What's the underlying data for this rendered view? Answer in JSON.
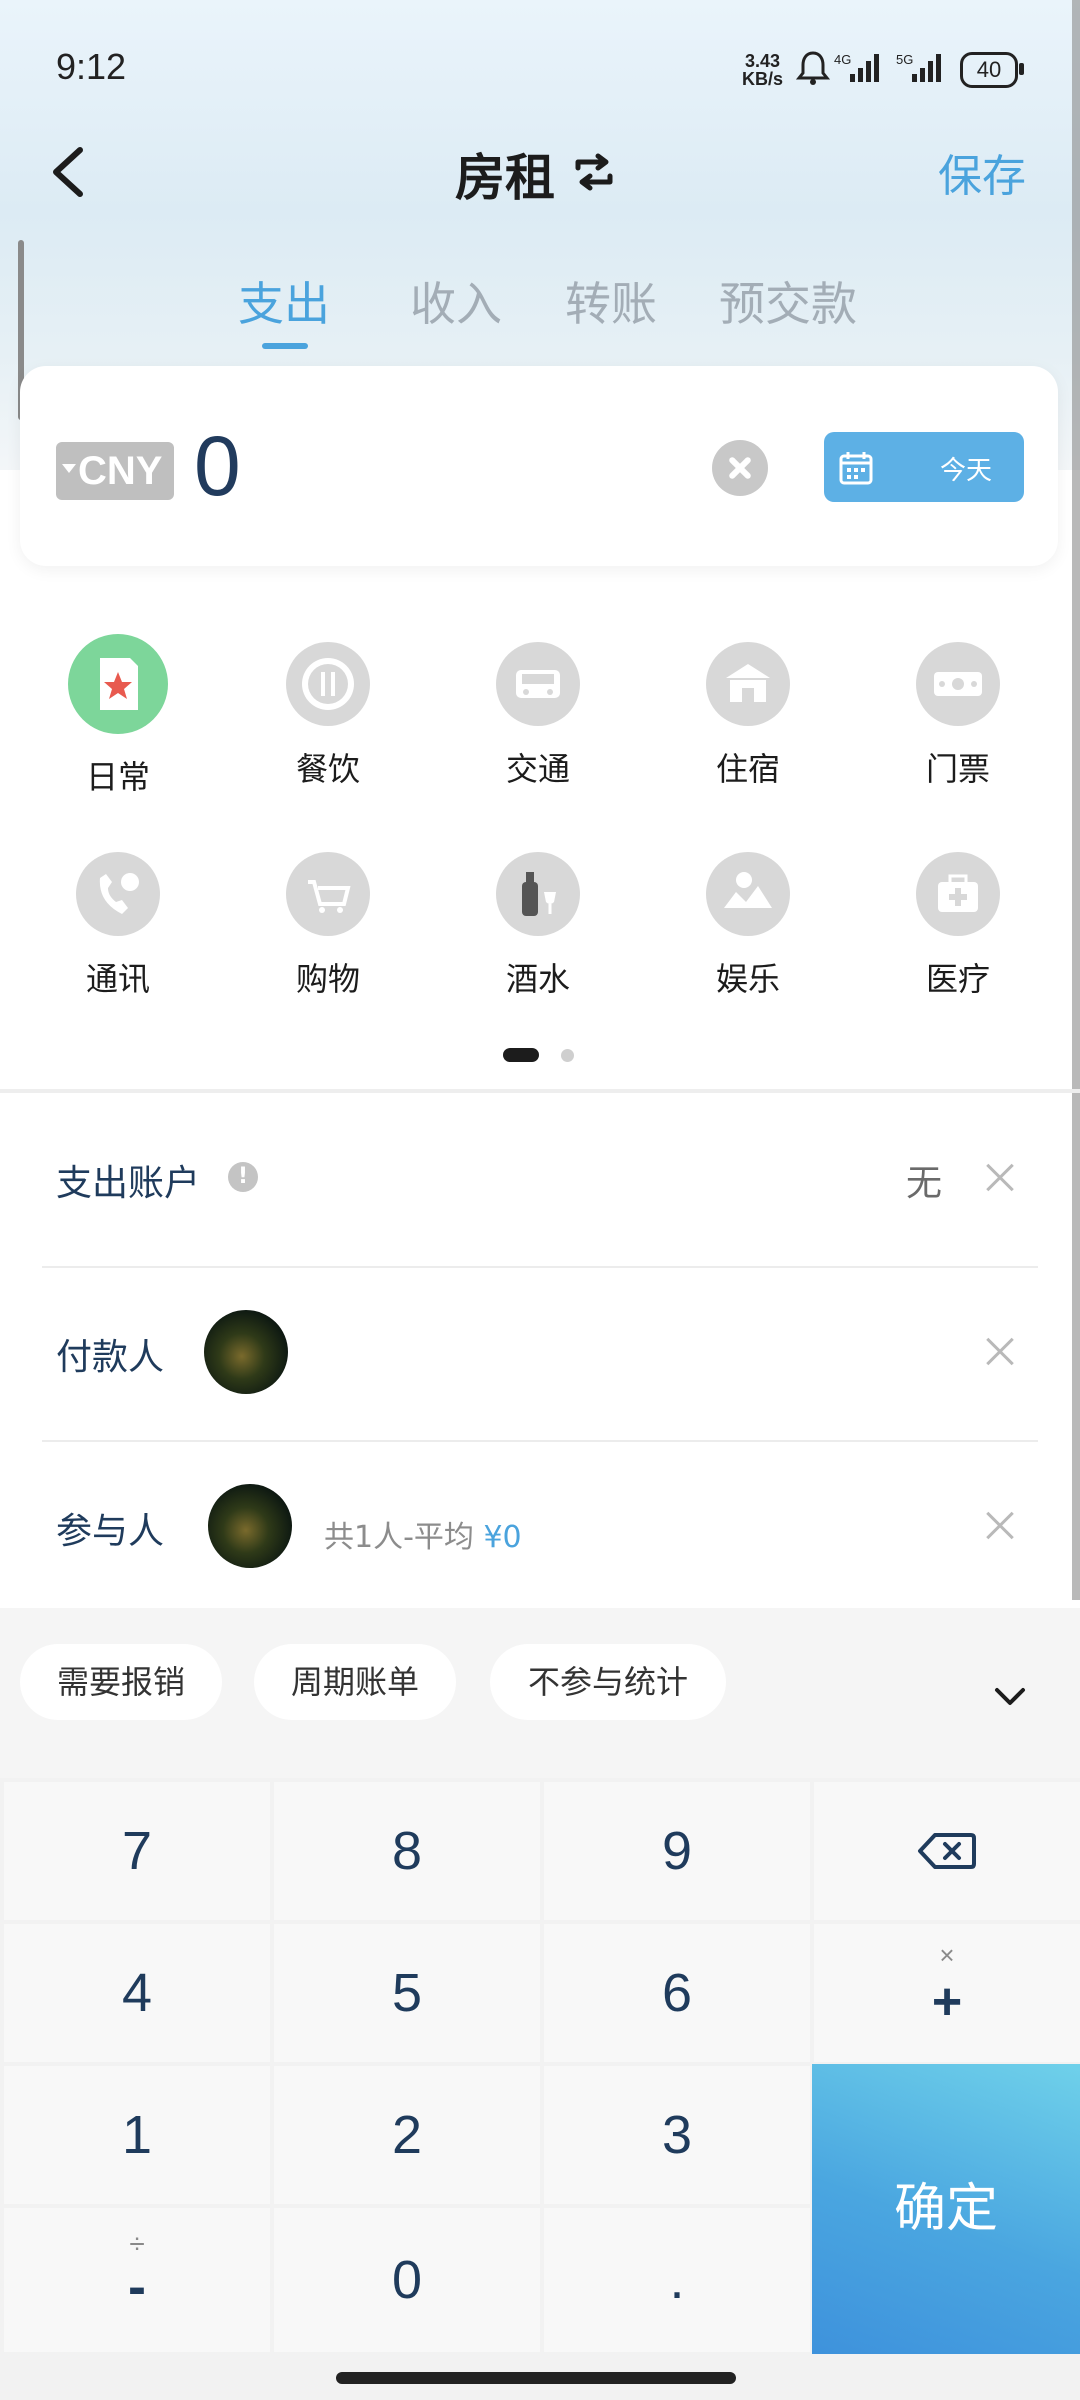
{
  "status": {
    "time": "9:12",
    "speed_value": "3.43",
    "speed_unit": "KB/s",
    "net1": "4G",
    "net2": "5G",
    "battery": "40"
  },
  "header": {
    "title": "房租",
    "save": "保存"
  },
  "tabs": [
    {
      "label": "支出",
      "active": true
    },
    {
      "label": "收入",
      "active": false
    },
    {
      "label": "转账",
      "active": false
    },
    {
      "label": "预交款",
      "active": false
    }
  ],
  "amount": {
    "currency": "CNY",
    "value": "0",
    "date_label": "今天"
  },
  "categories": [
    {
      "label": "日常",
      "icon": "daily-icon"
    },
    {
      "label": "餐饮",
      "icon": "dining-icon"
    },
    {
      "label": "交通",
      "icon": "transport-icon"
    },
    {
      "label": "住宿",
      "icon": "lodging-icon"
    },
    {
      "label": "门票",
      "icon": "ticket-icon"
    },
    {
      "label": "通讯",
      "icon": "phone-icon"
    },
    {
      "label": "购物",
      "icon": "shopping-icon"
    },
    {
      "label": "酒水",
      "icon": "drinks-icon"
    },
    {
      "label": "娱乐",
      "icon": "entertainment-icon"
    },
    {
      "label": "医疗",
      "icon": "medical-icon"
    }
  ],
  "rows": {
    "account_label": "支出账户",
    "account_value": "无",
    "payer_label": "付款人",
    "participants_label": "参与人",
    "split_text": "共1人-平均",
    "split_amount": "¥0"
  },
  "tags": [
    "需要报销",
    "周期账单",
    "不参与统计"
  ],
  "keypad": {
    "k7": "7",
    "k8": "8",
    "k9": "9",
    "k4": "4",
    "k5": "5",
    "k6": "6",
    "k1": "1",
    "k2": "2",
    "k3": "3",
    "k0": "0",
    "dot": ".",
    "times": "×",
    "plus": "+",
    "divide": "÷",
    "minus": "-",
    "confirm": "确定"
  },
  "colors": {
    "accent": "#4aa3dd",
    "category_active": "#7dd69a",
    "confirm_gradient_start": "#6fd1ea",
    "confirm_gradient_end": "#3e92dc"
  }
}
